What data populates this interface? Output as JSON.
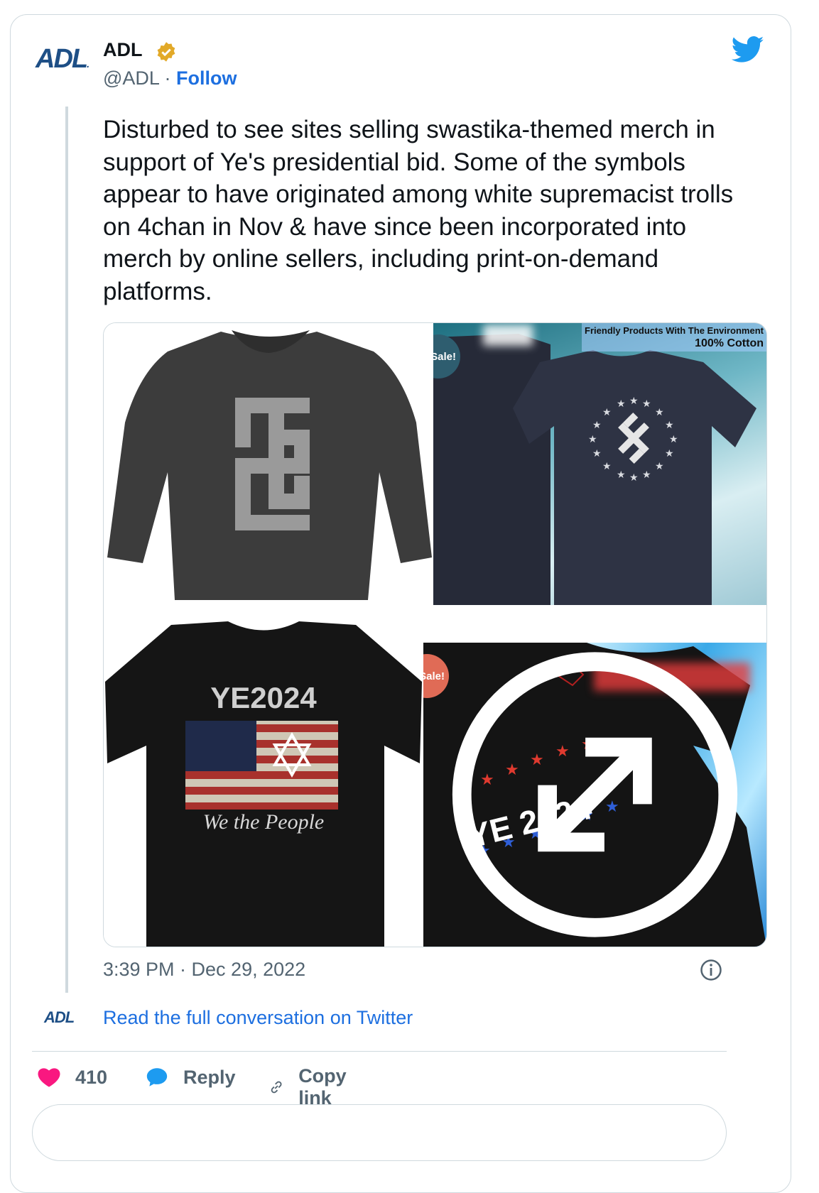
{
  "author": {
    "avatar_text": "ADL",
    "name": "ADL",
    "handle": "@ADL",
    "separator": "·",
    "follow_label": "Follow"
  },
  "tweet": {
    "text": "Disturbed to see sites selling swastika-themed merch in support of Ye's presidential bid. Some of the symbols appear to have originated among white supremacist trolls on 4chan in Nov & have since been incorporated into merch by online sellers, including print-on-demand platforms.",
    "timestamp": "3:39 PM · Dec 29, 2022"
  },
  "media": {
    "images": [
      {
        "name": "long-sleeve-shirt"
      },
      {
        "name": "navy-tshirt-stars",
        "sale": "Sale!",
        "banner_line1": "Friendly Products With The Environment",
        "banner_line2": "100% Cotton"
      },
      {
        "name": "black-tshirt-flag",
        "print_title": "YE2024",
        "print_subtitle": "We the People"
      },
      {
        "name": "black-tshirt-ye",
        "sale": "Sale!",
        "print_text": "YE 2024"
      }
    ]
  },
  "footer": {
    "read_logo": "ADL",
    "read_link": "Read the full conversation on Twitter",
    "like_count": "410",
    "reply_label": "Reply",
    "copy_label": "Copy link"
  },
  "colors": {
    "link": "#1d6fe0",
    "verified": "#e2a928",
    "twitter_blue": "#1d9bf0",
    "like_red": "#f91880",
    "adl_blue": "#1e4f86"
  }
}
